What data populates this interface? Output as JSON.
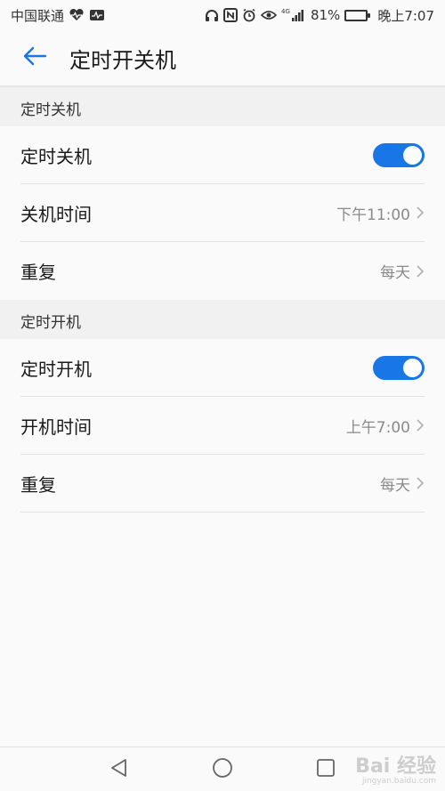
{
  "status_bar": {
    "carrier": "中国联通",
    "network_label": "4G",
    "battery_percent_text": "81%",
    "battery_level": 0.81,
    "time": "晚上7:07",
    "icons": [
      "heart-rate-icon",
      "activity-icon",
      "headset-icon",
      "nfc-icon",
      "alarm-icon",
      "eye-icon",
      "signal-icon",
      "battery-icon"
    ]
  },
  "header": {
    "title": "定时开关机",
    "back_icon": "arrow-left-icon",
    "accent_color": "#1976e6"
  },
  "sections": [
    {
      "header": "定时关机",
      "toggle_row": {
        "label": "定时关机",
        "enabled": true
      },
      "time_row": {
        "label": "关机时间",
        "value": "下午11:00"
      },
      "repeat_row": {
        "label": "重复",
        "value": "每天"
      }
    },
    {
      "header": "定时开机",
      "toggle_row": {
        "label": "定时开机",
        "enabled": true
      },
      "time_row": {
        "label": "开机时间",
        "value": "上午7:00"
      },
      "repeat_row": {
        "label": "重复",
        "value": "每天"
      }
    }
  ],
  "nav_bar": {
    "buttons": [
      "back-triangle-icon",
      "home-circle-icon",
      "recents-square-icon"
    ]
  },
  "watermark": {
    "text": "Bai 经验",
    "subtext": "jingyan.baidu.com"
  }
}
